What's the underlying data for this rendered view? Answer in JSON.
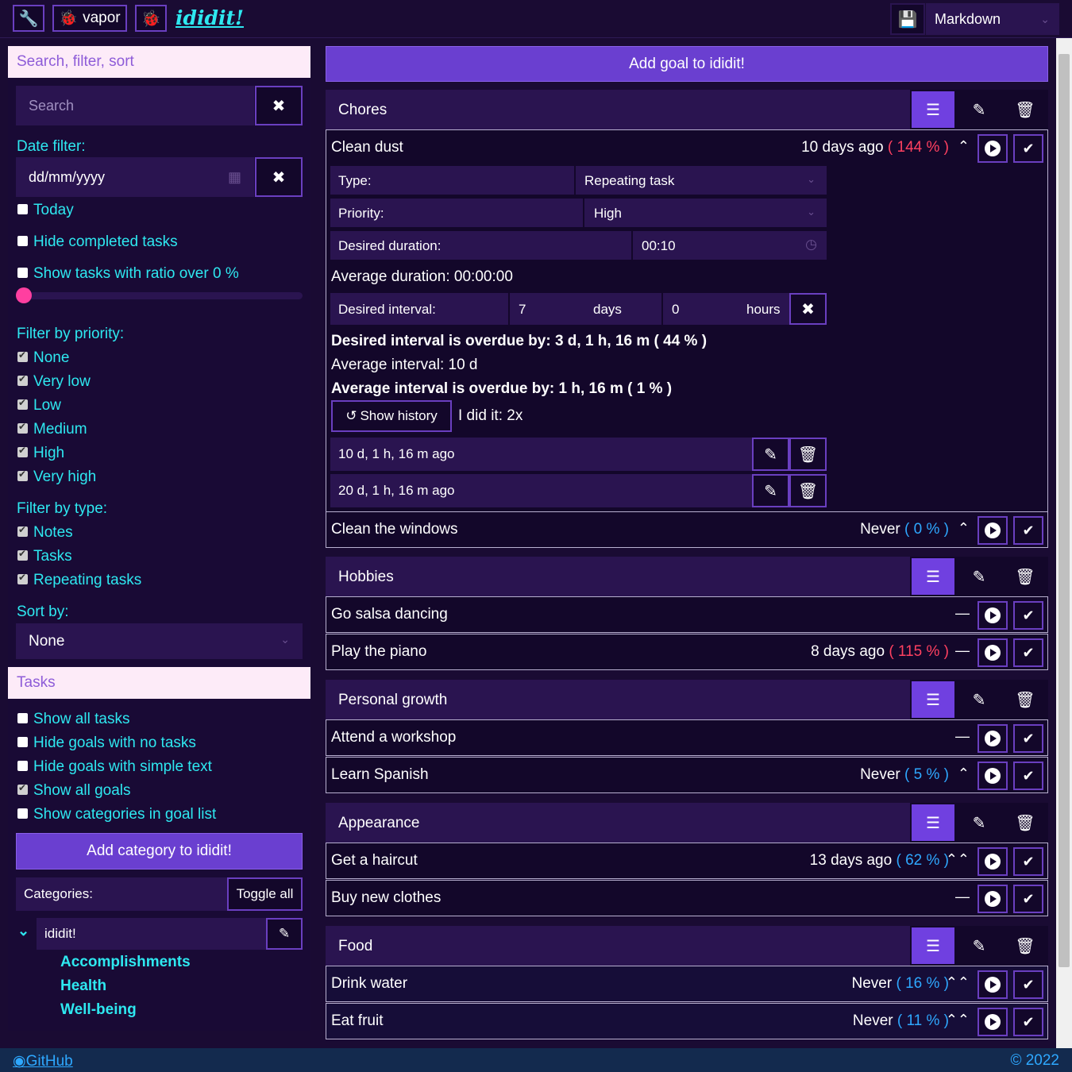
{
  "topbar": {
    "vapor_label": "vapor",
    "app_name": "ididit!",
    "format_select": "Markdown"
  },
  "sidebar": {
    "search_section": "Search, filter, sort",
    "search_placeholder": "Search",
    "date_filter_label": "Date filter:",
    "date_placeholder": "dd/mm/yyyy",
    "today": "Today",
    "hide_completed": "Hide completed tasks",
    "show_ratio": "Show tasks with ratio over 0 %",
    "filter_priority_label": "Filter by priority:",
    "priorities": [
      "None",
      "Very low",
      "Low",
      "Medium",
      "High",
      "Very high"
    ],
    "filter_type_label": "Filter by type:",
    "types": [
      "Notes",
      "Tasks",
      "Repeating tasks"
    ],
    "sort_by_label": "Sort by:",
    "sort_value": "None",
    "tasks_section": "Tasks",
    "task_opts": [
      {
        "label": "Show all tasks",
        "checked": false
      },
      {
        "label": "Hide goals with no tasks",
        "checked": false
      },
      {
        "label": "Hide goals with simple text",
        "checked": false
      },
      {
        "label": "Show all goals",
        "checked": true
      },
      {
        "label": "Show categories in goal list",
        "checked": false
      }
    ],
    "add_category": "Add category to ididit!",
    "categories_label": "Categories:",
    "toggle_all": "Toggle all",
    "category_root": "ididit!",
    "category_children": [
      "Accomplishments",
      "Health",
      "Well-being"
    ]
  },
  "main": {
    "add_goal": "Add goal to ididit!",
    "goals": [
      {
        "name": "Chores",
        "tasks": [
          {
            "name": "Clean dust",
            "meta": "10 days ago",
            "pct": "( 144 % )",
            "pct_color": "red",
            "arrow": "⌃"
          },
          {
            "name": "Clean the windows",
            "meta": "Never",
            "pct": "( 0 % )",
            "pct_color": "cyan",
            "arrow": "⌃"
          }
        ]
      },
      {
        "name": "Hobbies",
        "tasks": [
          {
            "name": "Go salsa dancing",
            "meta": "",
            "pct": "",
            "pct_color": "",
            "arrow": "—"
          },
          {
            "name": "Play the piano",
            "meta": "8 days ago",
            "pct": "( 115 % )",
            "pct_color": "red",
            "arrow": "—"
          }
        ]
      },
      {
        "name": "Personal growth",
        "tasks": [
          {
            "name": "Attend a workshop",
            "meta": "",
            "pct": "",
            "pct_color": "",
            "arrow": "—"
          },
          {
            "name": "Learn Spanish",
            "meta": "Never",
            "pct": "( 5 % )",
            "pct_color": "cyan",
            "arrow": "⌃"
          }
        ]
      },
      {
        "name": "Appearance",
        "tasks": [
          {
            "name": "Get a haircut",
            "meta": "13 days ago",
            "pct": "( 62 % )",
            "pct_color": "cyan",
            "arrow": "⌃⌃"
          },
          {
            "name": "Buy new clothes",
            "meta": "",
            "pct": "",
            "pct_color": "",
            "arrow": "—"
          }
        ]
      },
      {
        "name": "Food",
        "tasks": [
          {
            "name": "Drink water",
            "meta": "Never",
            "pct": "( 16 % )",
            "pct_color": "cyan",
            "arrow": "⌃⌃"
          },
          {
            "name": "Eat fruit",
            "meta": "Never",
            "pct": "( 11 % )",
            "pct_color": "cyan",
            "arrow": "⌃⌃"
          }
        ]
      }
    ],
    "detail": {
      "type_label": "Type:",
      "type_value": "Repeating task",
      "priority_label": "Priority:",
      "priority_value": "High",
      "duration_label": "Desired duration:",
      "duration_value": "00:10",
      "avg_duration": "Average duration: 00:00:00",
      "interval_label": "Desired interval:",
      "interval_days": "7",
      "days_label": "days",
      "interval_hours": "0",
      "hours_label": "hours",
      "overdue": "Desired interval is overdue by: 3 d, 1 h, 16 m ( 44 % )",
      "avg_interval": "Average interval: 10 d",
      "avg_overdue": "Average interval is overdue by: 1 h, 16 m ( 1 % )",
      "show_history": "Show history",
      "did_it": "I did it: 2x",
      "history": [
        "10 d, 1 h, 16 m ago",
        "20 d, 1 h, 16 m ago"
      ]
    }
  },
  "footer": {
    "github": "GitHub",
    "copyright": "© 2022"
  }
}
